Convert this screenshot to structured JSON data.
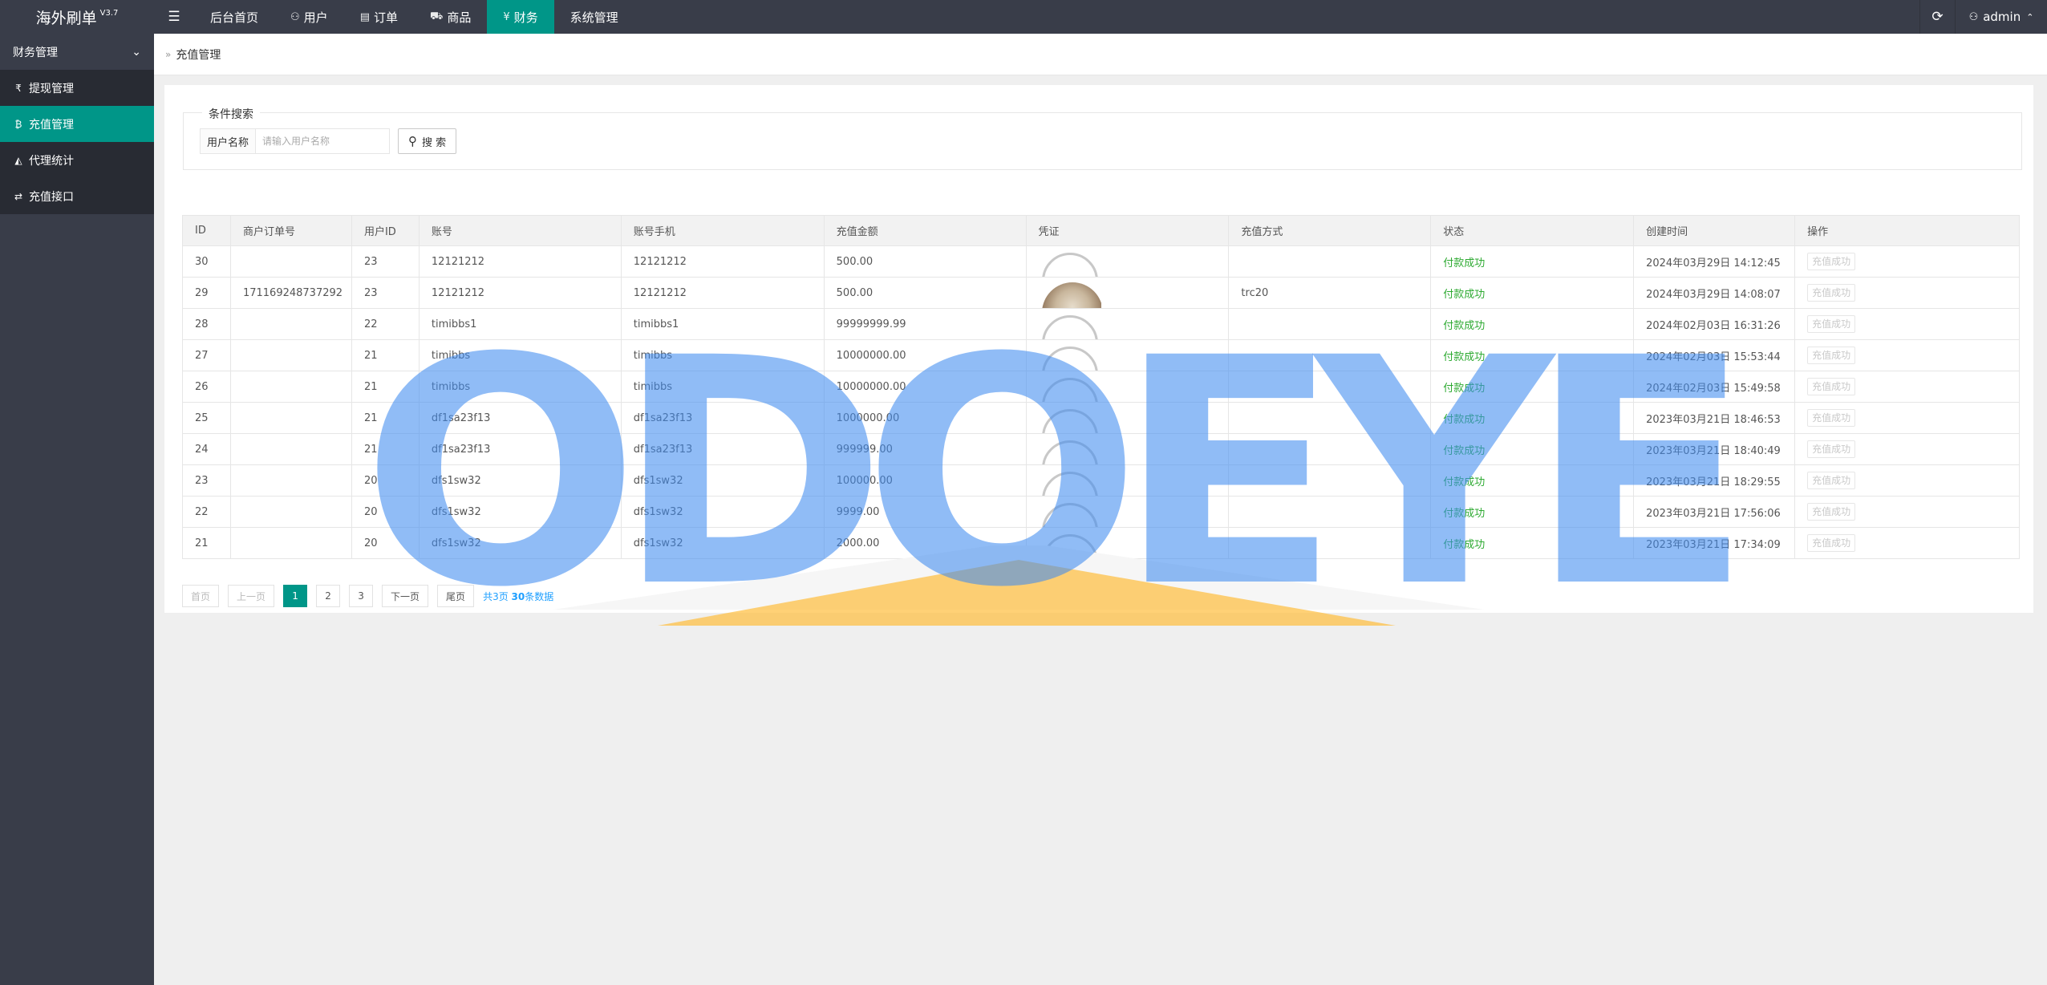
{
  "app": {
    "name": "海外刷单",
    "version": "V3.7"
  },
  "header": {
    "menu_toggle": "☰",
    "nav": [
      {
        "label": "后台首页",
        "icon": ""
      },
      {
        "label": "用户",
        "icon": "user-icon"
      },
      {
        "label": "订单",
        "icon": "document-icon"
      },
      {
        "label": "商品",
        "icon": "cart-icon"
      },
      {
        "label": "财务",
        "icon": "yen-icon",
        "active": true
      },
      {
        "label": "系统管理",
        "icon": ""
      }
    ],
    "user": "admin"
  },
  "sidebar": {
    "group": "财务管理",
    "items": [
      {
        "label": "提现管理",
        "icon": "rupee-icon"
      },
      {
        "label": "充值管理",
        "icon": "bitcoin-icon",
        "active": true
      },
      {
        "label": "代理统计",
        "icon": "area-chart-icon"
      },
      {
        "label": "充值接口",
        "icon": "exchange-icon"
      }
    ]
  },
  "breadcrumb": "充值管理",
  "search": {
    "legend": "条件搜索",
    "label": "用户名称",
    "placeholder": "请输入用户名称",
    "button": "搜 索"
  },
  "table": {
    "columns": [
      "ID",
      "商户订单号",
      "用户ID",
      "账号",
      "账号手机",
      "充值金额",
      "凭证",
      "充值方式",
      "状态",
      "创建时间",
      "操作"
    ],
    "rows": [
      [
        "30",
        "",
        "23",
        "12121212",
        "12121212",
        "500.00",
        "ring",
        "",
        "付款成功",
        "2024年03月29日 14:12:45",
        "充值成功"
      ],
      [
        "29",
        "171169248737292",
        "23",
        "12121212",
        "12121212",
        "500.00",
        "photo",
        "trc20",
        "付款成功",
        "2024年03月29日 14:08:07",
        "充值成功"
      ],
      [
        "28",
        "",
        "22",
        "timibbs1",
        "timibbs1",
        "99999999.99",
        "ring",
        "",
        "付款成功",
        "2024年02月03日 16:31:26",
        "充值成功"
      ],
      [
        "27",
        "",
        "21",
        "timibbs",
        "timibbs",
        "10000000.00",
        "ring",
        "",
        "付款成功",
        "2024年02月03日 15:53:44",
        "充值成功"
      ],
      [
        "26",
        "",
        "21",
        "timibbs",
        "timibbs",
        "10000000.00",
        "ring",
        "",
        "付款成功",
        "2024年02月03日 15:49:58",
        "充值成功"
      ],
      [
        "25",
        "",
        "21",
        "df1sa23f13",
        "df1sa23f13",
        "1000000.00",
        "ring",
        "",
        "付款成功",
        "2023年03月21日 18:46:53",
        "充值成功"
      ],
      [
        "24",
        "",
        "21",
        "df1sa23f13",
        "df1sa23f13",
        "999999.00",
        "ring",
        "",
        "付款成功",
        "2023年03月21日 18:40:49",
        "充值成功"
      ],
      [
        "23",
        "",
        "20",
        "dfs1sw32",
        "dfs1sw32",
        "100000.00",
        "ring",
        "",
        "付款成功",
        "2023年03月21日 18:29:55",
        "充值成功"
      ],
      [
        "22",
        "",
        "20",
        "dfs1sw32",
        "dfs1sw32",
        "9999.00",
        "ring",
        "",
        "付款成功",
        "2023年03月21日 17:56:06",
        "充值成功"
      ],
      [
        "21",
        "",
        "20",
        "dfs1sw32",
        "dfs1sw32",
        "2000.00",
        "ring",
        "",
        "付款成功",
        "2023年03月21日 17:34:09",
        "充值成功"
      ]
    ]
  },
  "pager": {
    "first": "首页",
    "prev": "上一页",
    "pages": [
      "1",
      "2",
      "3"
    ],
    "current": "1",
    "next": "下一页",
    "last": "尾页",
    "total_prefix": "共3页",
    "total_count": "30",
    "total_suffix": "条数据"
  },
  "watermark": "ODOEYE",
  "colors": {
    "header": "#393d49",
    "accent": "#009688",
    "success": "#2eaa32",
    "link": "#1e9fff"
  }
}
